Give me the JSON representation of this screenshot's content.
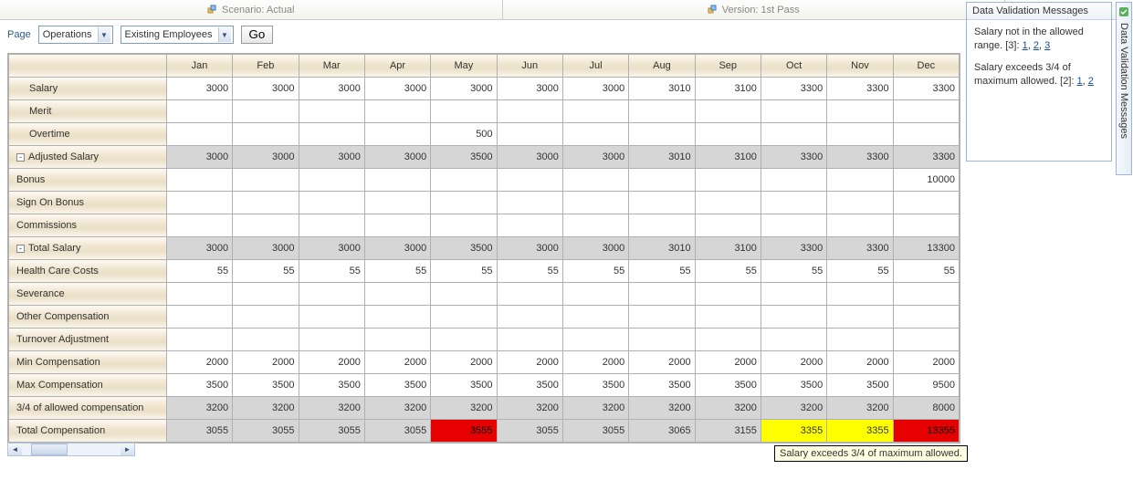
{
  "topbar": {
    "scenario_label": "Scenario: Actual",
    "version_label": "Version: 1st Pass"
  },
  "controls": {
    "page_label": "Page",
    "department_value": "Operations",
    "employees_value": "Existing Employees",
    "go_label": "Go"
  },
  "columns": [
    "Jan",
    "Feb",
    "Mar",
    "Apr",
    "May",
    "Jun",
    "Jul",
    "Aug",
    "Sep",
    "Oct",
    "Nov",
    "Dec"
  ],
  "rows": [
    {
      "label": "Salary",
      "indent": 1,
      "cells": [
        "3000",
        "3000",
        "3000",
        "3000",
        "3000",
        "3000",
        "3000",
        "3010",
        "3100",
        "3300",
        "3300",
        "3300"
      ]
    },
    {
      "label": "Merit",
      "indent": 1,
      "cells": [
        "",
        "",
        "",
        "",
        "",
        "",
        "",
        "",
        "",
        "",
        "",
        ""
      ]
    },
    {
      "label": "Overtime",
      "indent": 1,
      "cells": [
        "",
        "",
        "",
        "",
        "500",
        "",
        "",
        "",
        "",
        "",
        "",
        ""
      ]
    },
    {
      "label": "Adjusted Salary",
      "indent": 0,
      "toggle": true,
      "shaded": true,
      "cells": [
        "3000",
        "3000",
        "3000",
        "3000",
        "3500",
        "3000",
        "3000",
        "3010",
        "3100",
        "3300",
        "3300",
        "3300"
      ]
    },
    {
      "label": "Bonus",
      "indent": 0,
      "cells": [
        "",
        "",
        "",
        "",
        "",
        "",
        "",
        "",
        "",
        "",
        "",
        "10000"
      ]
    },
    {
      "label": "Sign On Bonus",
      "indent": 0,
      "cells": [
        "",
        "",
        "",
        "",
        "",
        "",
        "",
        "",
        "",
        "",
        "",
        ""
      ]
    },
    {
      "label": "Commissions",
      "indent": 0,
      "cells": [
        "",
        "",
        "",
        "",
        "",
        "",
        "",
        "",
        "",
        "",
        "",
        ""
      ]
    },
    {
      "label": "Total Salary",
      "indent": 0,
      "toggle": true,
      "shaded": true,
      "cells": [
        "3000",
        "3000",
        "3000",
        "3000",
        "3500",
        "3000",
        "3000",
        "3010",
        "3100",
        "3300",
        "3300",
        "13300"
      ]
    },
    {
      "label": "Health Care Costs",
      "indent": 0,
      "cells": [
        "55",
        "55",
        "55",
        "55",
        "55",
        "55",
        "55",
        "55",
        "55",
        "55",
        "55",
        "55"
      ]
    },
    {
      "label": "Severance",
      "indent": 0,
      "cells": [
        "",
        "",
        "",
        "",
        "",
        "",
        "",
        "",
        "",
        "",
        "",
        ""
      ]
    },
    {
      "label": "Other Compensation",
      "indent": 0,
      "cells": [
        "",
        "",
        "",
        "",
        "",
        "",
        "",
        "",
        "",
        "",
        "",
        ""
      ]
    },
    {
      "label": "Turnover Adjustment",
      "indent": 0,
      "cells": [
        "",
        "",
        "",
        "",
        "",
        "",
        "",
        "",
        "",
        "",
        "",
        ""
      ]
    },
    {
      "label": "Min Compensation",
      "indent": 0,
      "cells": [
        "2000",
        "2000",
        "2000",
        "2000",
        "2000",
        "2000",
        "2000",
        "2000",
        "2000",
        "2000",
        "2000",
        "2000"
      ]
    },
    {
      "label": "Max Compensation",
      "indent": 0,
      "cells": [
        "3500",
        "3500",
        "3500",
        "3500",
        "3500",
        "3500",
        "3500",
        "3500",
        "3500",
        "3500",
        "3500",
        "9500"
      ]
    },
    {
      "label": "3/4 of allowed compensation",
      "indent": 0,
      "shaded": true,
      "cells": [
        "3200",
        "3200",
        "3200",
        "3200",
        "3200",
        "3200",
        "3200",
        "3200",
        "3200",
        "3200",
        "3200",
        "8000"
      ]
    },
    {
      "label": "Total Compensation",
      "indent": 0,
      "shaded": true,
      "cells": [
        "3055",
        "3055",
        "3055",
        "3055",
        "3555",
        "3055",
        "3055",
        "3065",
        "3155",
        "3355",
        "3355",
        "13355"
      ],
      "colors": [
        "",
        "",
        "",
        "",
        "red",
        "",
        "",
        "",
        "",
        "yellow",
        "yellow",
        "red"
      ]
    }
  ],
  "validation": {
    "title": "Data Validation Messages",
    "msg1_text": "Salary not in the allowed range. [3]: ",
    "msg1_links": [
      "1",
      "2",
      "3"
    ],
    "msg2_text": "Salary exceeds 3/4 of maximum allowed. [2]: ",
    "msg2_links": [
      "1",
      "2"
    ]
  },
  "side_tab_label": "Data Validation Messages",
  "tooltip_text": "Salary exceeds 3/4 of maximum allowed."
}
